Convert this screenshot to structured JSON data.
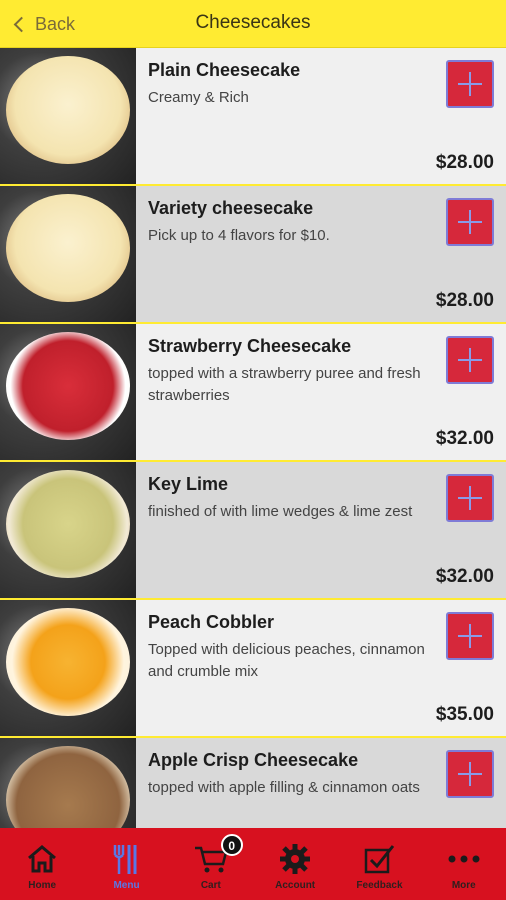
{
  "header": {
    "back_label": "Back",
    "title": "Cheesecakes"
  },
  "items": [
    {
      "name": "Plain Cheesecake",
      "desc": "Creamy & Rich",
      "price": "$28.00",
      "style": "plain"
    },
    {
      "name": "Variety cheesecake",
      "desc": "Pick up to 4 flavors for $10.",
      "price": "$28.00",
      "style": "plain"
    },
    {
      "name": "Strawberry Cheesecake",
      "desc": "topped with a strawberry puree and fresh strawberries",
      "price": "$32.00",
      "style": "straw"
    },
    {
      "name": "Key Lime",
      "desc": "finished of with lime wedges & lime zest",
      "price": "$32.00",
      "style": "lime"
    },
    {
      "name": "Peach Cobbler",
      "desc": "Topped with delicious peaches, cinnamon and crumble mix",
      "price": "$35.00",
      "style": "peach"
    },
    {
      "name": "Apple Crisp Cheesecake",
      "desc": "topped with apple filling & cinnamon oats",
      "price": "",
      "style": "apple"
    }
  ],
  "tabbar": {
    "home": "Home",
    "menu": "Menu",
    "cart": "Cart",
    "cart_count": "0",
    "account": "Account",
    "feedback": "Feedback",
    "more": "More"
  },
  "colors": {
    "header_bg": "#FFEB32",
    "tabbar_bg": "#D7111F",
    "add_button_bg": "#D6283B",
    "active_tab": "#5A78E6"
  }
}
